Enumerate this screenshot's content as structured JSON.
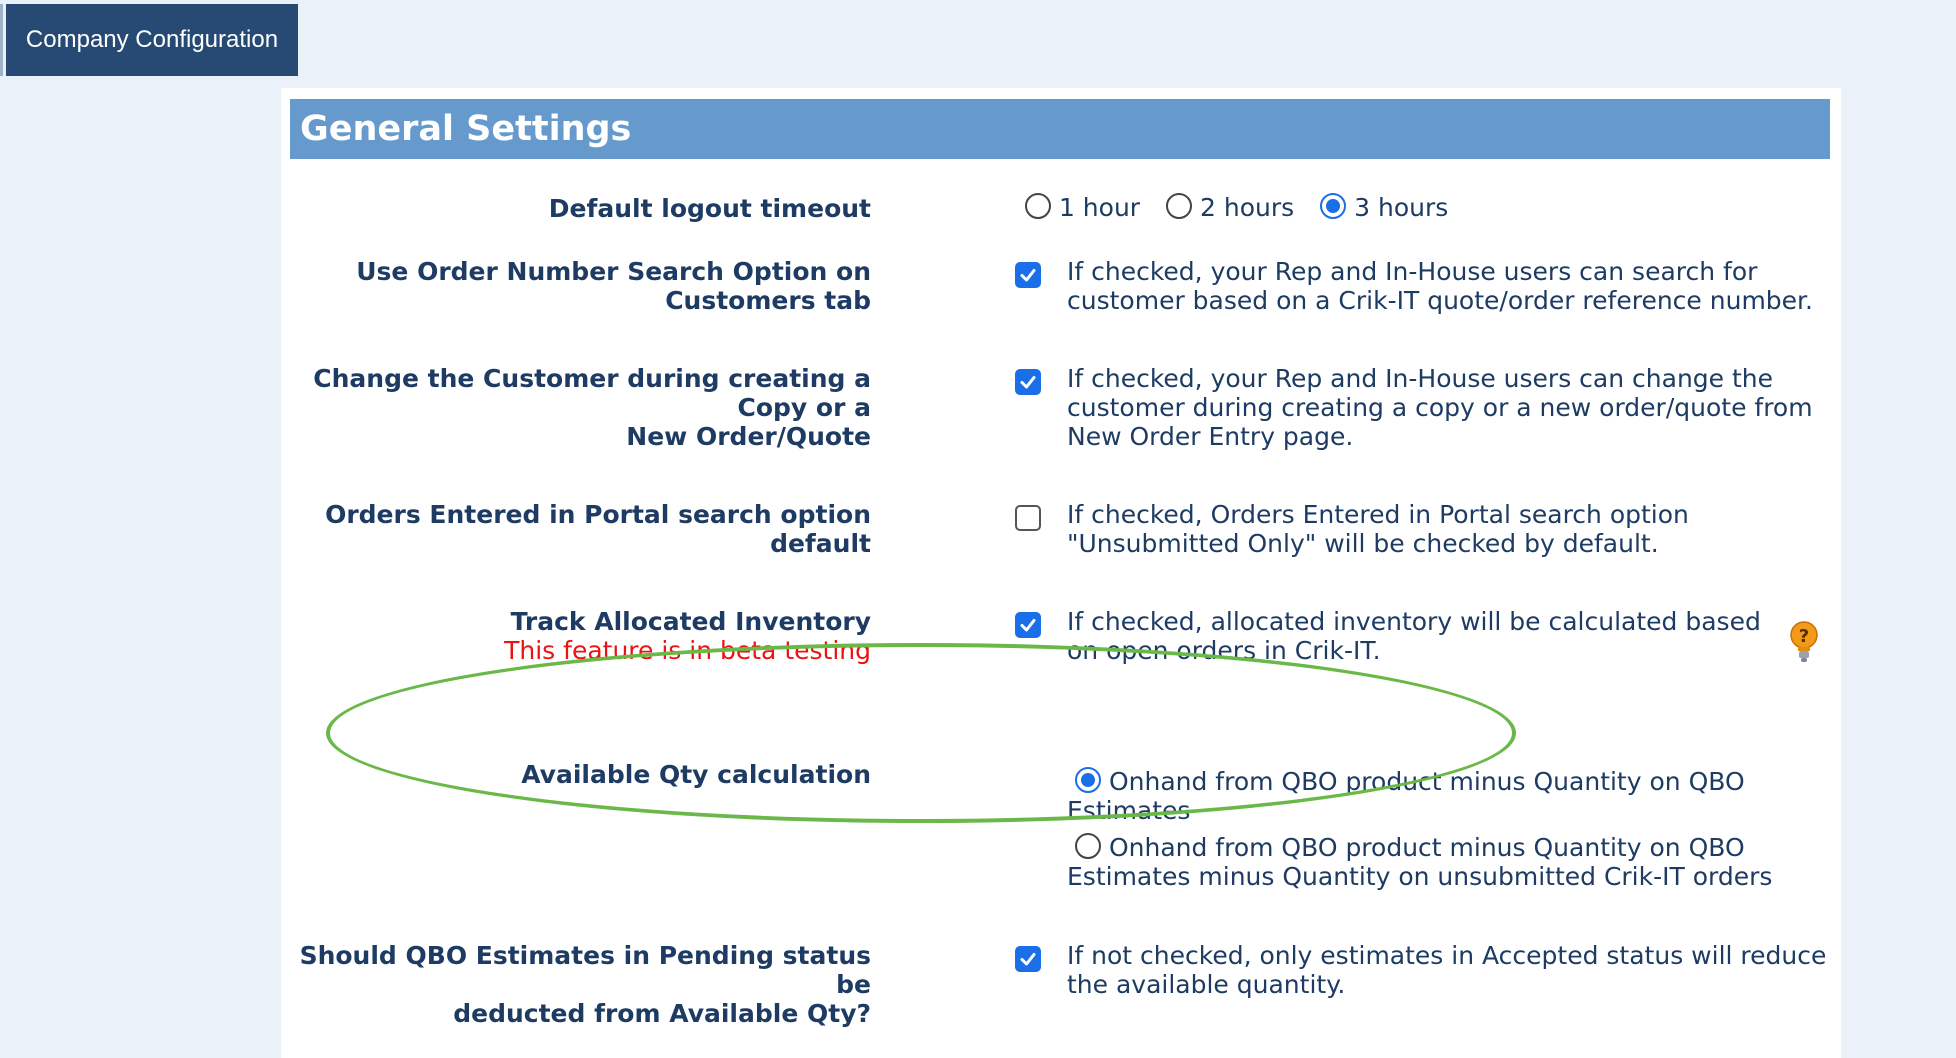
{
  "tab": {
    "label": "Company Configuration"
  },
  "panel": {
    "title": "General Settings"
  },
  "logout": {
    "label": "Default logout timeout",
    "options": [
      "1 hour",
      "2 hours",
      "3 hours"
    ],
    "selected": "3 hours"
  },
  "settings": [
    {
      "label_lines": [
        "Use Order Number Search Option on Customers tab"
      ],
      "checked": true,
      "desc_lines": [
        "If checked, your Rep and In-House users can search for",
        "customer based on a Crik-IT quote/order reference number."
      ]
    },
    {
      "label_lines": [
        "Change the Customer during creating a Copy or a",
        "New Order/Quote"
      ],
      "checked": true,
      "desc_lines": [
        "If checked, your Rep and In-House users can change the",
        "customer during creating a copy or a new order/quote from",
        "New Order Entry page."
      ]
    },
    {
      "label_lines": [
        "Orders Entered in Portal search option default"
      ],
      "checked": false,
      "desc_lines": [
        "If checked, Orders Entered in Portal search option",
        "\"Unsubmitted Only\" will be checked by default."
      ]
    },
    {
      "label_lines": [
        "Track Allocated Inventory"
      ],
      "beta_note": "This feature is in beta testing",
      "checked": true,
      "desc_lines": [
        "If checked, allocated inventory will be calculated based",
        "on open orders in Crik-IT."
      ],
      "help_icon": "lightbulb-question-icon"
    }
  ],
  "available_qty": {
    "label": "Available Qty calculation",
    "options": [
      {
        "lines": [
          "Onhand from QBO product minus Quantity on QBO",
          "Estimates"
        ],
        "selected": true
      },
      {
        "lines": [
          "Onhand from QBO product minus Quantity on QBO",
          "Estimates minus Quantity on unsubmitted Crik-IT orders"
        ],
        "selected": false
      }
    ],
    "highlight_color": "#6ab847"
  },
  "pending": {
    "label_lines": [
      "Should QBO Estimates in Pending status be",
      "deducted from Available Qty?"
    ],
    "checked": true,
    "desc_lines": [
      "If not checked, only estimates in Accepted status will reduce",
      "the available quantity."
    ]
  },
  "colors": {
    "header_bg": "#6699cc",
    "tab_bg": "#264a73",
    "text": "#1d3b63",
    "beta": "#ee1111",
    "checkbox": "#1a6fe8"
  }
}
